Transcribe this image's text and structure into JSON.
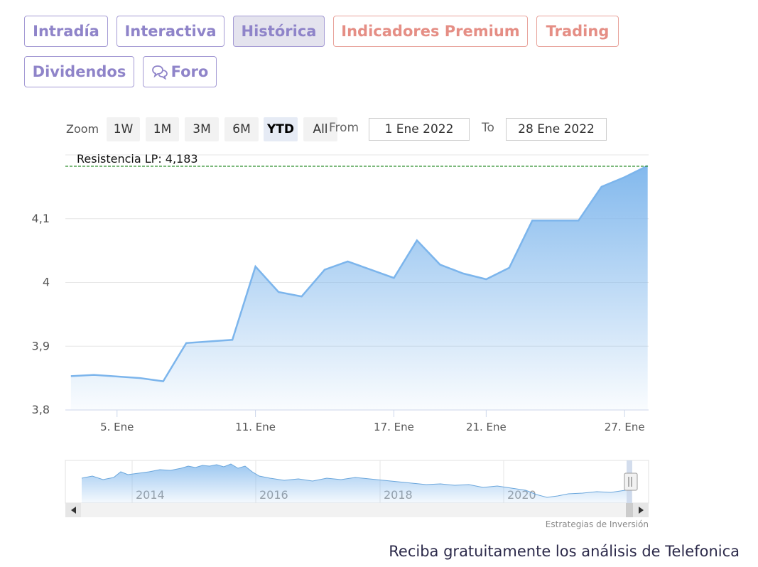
{
  "tabs": [
    {
      "label": "Intradía",
      "style": "normal"
    },
    {
      "label": "Interactiva",
      "style": "normal"
    },
    {
      "label": "Histórica",
      "style": "active"
    },
    {
      "label": "Indicadores Premium",
      "style": "premium"
    },
    {
      "label": "Trading",
      "style": "premium"
    },
    {
      "label": "Dividendos",
      "style": "normal"
    },
    {
      "label": "Foro",
      "style": "normal",
      "icon": "chat-bubbles-icon"
    }
  ],
  "zoom": {
    "label": "Zoom",
    "buttons": [
      "1W",
      "1M",
      "3M",
      "6M",
      "YTD",
      "All"
    ],
    "selected": "YTD"
  },
  "range": {
    "from_label": "From",
    "from_value": "1 Ene 2022",
    "to_label": "To",
    "to_value": "28 Ene 2022"
  },
  "colors": {
    "line": "#7cb5ec",
    "accent": "#8f84c9",
    "premium": "#e58e85",
    "resistance_line": "#2f8f2f"
  },
  "chart_data": {
    "type": "area",
    "resistance_label": "Resistencia LP: 4,183",
    "resistance_value": 4.183,
    "x": [
      "2022-01-03",
      "2022-01-04",
      "2022-01-06",
      "2022-01-07",
      "2022-01-08",
      "2022-01-10",
      "2022-01-11",
      "2022-01-12",
      "2022-01-13",
      "2022-01-14",
      "2022-01-15",
      "2022-01-17",
      "2022-01-18",
      "2022-01-19",
      "2022-01-20",
      "2022-01-21",
      "2022-01-22",
      "2022-01-23",
      "2022-01-25",
      "2022-01-26",
      "2022-01-27",
      "2022-01-28"
    ],
    "y": [
      3.853,
      3.855,
      3.85,
      3.845,
      3.905,
      3.91,
      4.025,
      3.985,
      3.978,
      4.02,
      4.033,
      4.007,
      4.066,
      4.028,
      4.014,
      4.005,
      4.023,
      4.097,
      4.097,
      4.15,
      4.165,
      4.183
    ],
    "x_ticks": [
      "5. Ene",
      "11. Ene",
      "17. Ene",
      "21. Ene",
      "27. Ene"
    ],
    "y_ticks": [
      "3,8",
      "3,9",
      "4",
      "4,1"
    ],
    "ylim": [
      3.8,
      4.2
    ],
    "grid": true,
    "navigator": {
      "year_labels": [
        "2014",
        "2016",
        "2018",
        "2020"
      ]
    }
  },
  "credits": "Estrategias de Inversión",
  "footer": "Reciba gratuitamente los análisis de Telefonica"
}
